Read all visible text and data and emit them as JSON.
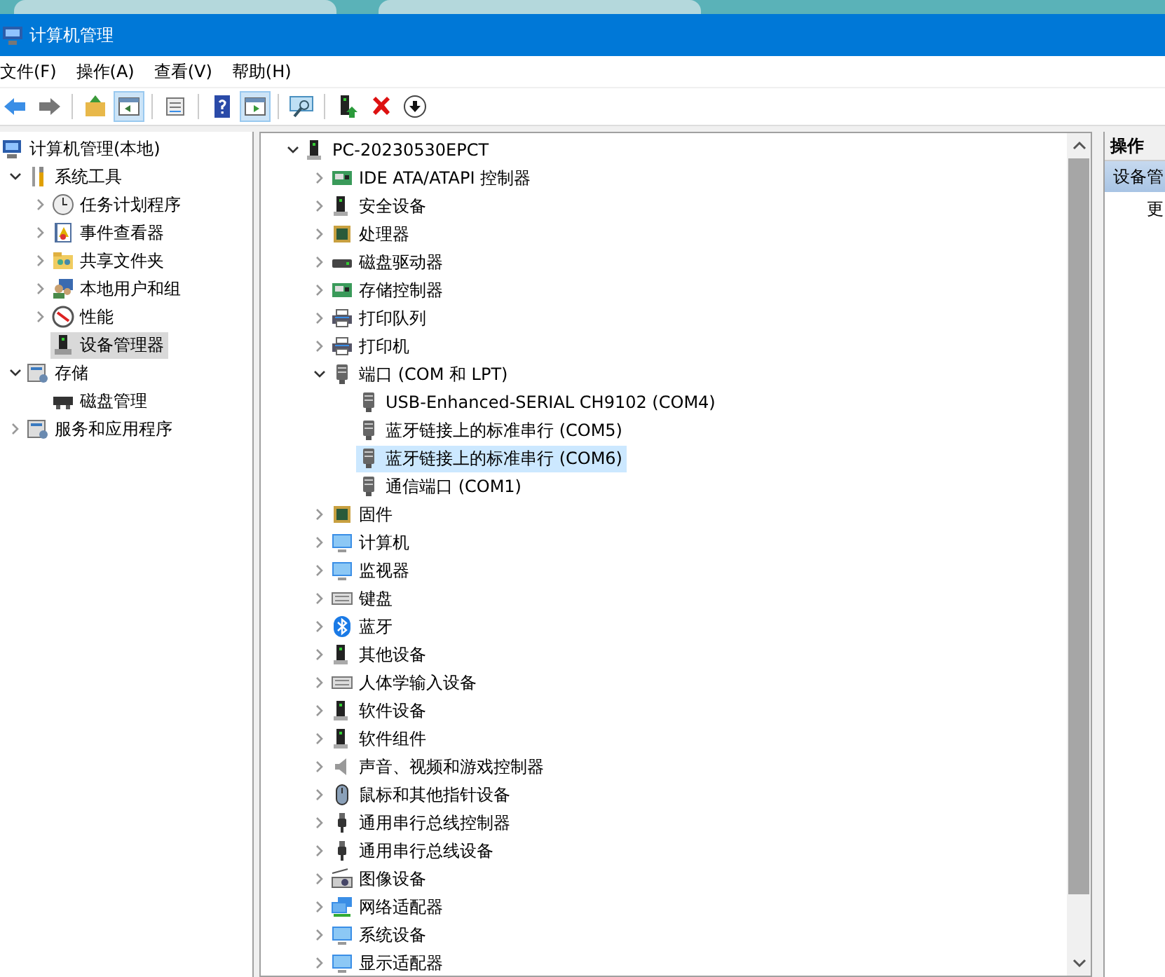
{
  "window": {
    "title": "计算机管理"
  },
  "menu": [
    "文件(F)",
    "操作(A)",
    "查看(V)",
    "帮助(H)"
  ],
  "toolbar": [
    {
      "kind": "back",
      "pressed": false
    },
    {
      "kind": "forward",
      "pressed": false
    },
    {
      "kind": "sep"
    },
    {
      "kind": "up",
      "pressed": false
    },
    {
      "kind": "tree",
      "pressed": true
    },
    {
      "kind": "sep"
    },
    {
      "kind": "properties",
      "pressed": false
    },
    {
      "kind": "sep"
    },
    {
      "kind": "help",
      "pressed": false
    },
    {
      "kind": "pane",
      "pressed": true
    },
    {
      "kind": "sep"
    },
    {
      "kind": "scan",
      "pressed": false
    },
    {
      "kind": "sep"
    },
    {
      "kind": "enable",
      "pressed": false
    },
    {
      "kind": "remove",
      "pressed": false
    },
    {
      "kind": "download",
      "pressed": false
    }
  ],
  "console_tree": [
    {
      "label": "计算机管理(本地)",
      "selected": false,
      "children": [
        {
          "label": "系统工具",
          "expanded": true,
          "selected": false,
          "children": [
            {
              "label": "任务计划程序",
              "expanded": false,
              "selected": false
            },
            {
              "label": "事件查看器",
              "expanded": false,
              "selected": false
            },
            {
              "label": "共享文件夹",
              "expanded": false,
              "selected": false
            },
            {
              "label": "本地用户和组",
              "expanded": false,
              "selected": false
            },
            {
              "label": "性能",
              "expanded": false,
              "selected": false
            },
            {
              "label": "设备管理器",
              "selected": true
            }
          ]
        },
        {
          "label": "存储",
          "expanded": true,
          "selected": false,
          "children": [
            {
              "label": "磁盘管理",
              "selected": false
            }
          ]
        },
        {
          "label": "服务和应用程序",
          "expanded": false,
          "selected": false
        }
      ]
    }
  ],
  "device_tree": [
    {
      "label": "PC-20230530EPCT",
      "expanded": true,
      "selected": false,
      "children": [
        {
          "label": "IDE ATA/ATAPI 控制器",
          "expanded": false,
          "selected": false
        },
        {
          "label": "安全设备",
          "expanded": false,
          "selected": false
        },
        {
          "label": "处理器",
          "expanded": false,
          "selected": false
        },
        {
          "label": "磁盘驱动器",
          "expanded": false,
          "selected": false
        },
        {
          "label": "存储控制器",
          "expanded": false,
          "selected": false
        },
        {
          "label": "打印队列",
          "expanded": false,
          "selected": false
        },
        {
          "label": "打印机",
          "expanded": false,
          "selected": false
        },
        {
          "label": "端口 (COM 和 LPT)",
          "expanded": true,
          "selected": false,
          "children": [
            {
              "label": "USB-Enhanced-SERIAL CH9102 (COM4)",
              "selected": false
            },
            {
              "label": "蓝牙链接上的标准串行 (COM5)",
              "selected": false
            },
            {
              "label": "蓝牙链接上的标准串行 (COM6)",
              "selected": true
            },
            {
              "label": "通信端口 (COM1)",
              "selected": false
            }
          ]
        },
        {
          "label": "固件",
          "expanded": false,
          "selected": false
        },
        {
          "label": "计算机",
          "expanded": false,
          "selected": false
        },
        {
          "label": "监视器",
          "expanded": false,
          "selected": false
        },
        {
          "label": "键盘",
          "expanded": false,
          "selected": false
        },
        {
          "label": "蓝牙",
          "expanded": false,
          "selected": false
        },
        {
          "label": "其他设备",
          "expanded": false,
          "selected": false
        },
        {
          "label": "人体学输入设备",
          "expanded": false,
          "selected": false
        },
        {
          "label": "软件设备",
          "expanded": false,
          "selected": false
        },
        {
          "label": "软件组件",
          "expanded": false,
          "selected": false
        },
        {
          "label": "声音、视频和游戏控制器",
          "expanded": false,
          "selected": false
        },
        {
          "label": "鼠标和其他指针设备",
          "expanded": false,
          "selected": false
        },
        {
          "label": "通用串行总线控制器",
          "expanded": false,
          "selected": false
        },
        {
          "label": "通用串行总线设备",
          "expanded": false,
          "selected": false
        },
        {
          "label": "图像设备",
          "expanded": false,
          "selected": false
        },
        {
          "label": "网络适配器",
          "expanded": false,
          "selected": false
        },
        {
          "label": "系统设备",
          "expanded": false,
          "selected": false
        },
        {
          "label": "显示适配器",
          "expanded": false,
          "selected": false
        }
      ]
    }
  ],
  "actions": {
    "title": "操作",
    "section": "设备管",
    "items": [
      "更"
    ]
  }
}
